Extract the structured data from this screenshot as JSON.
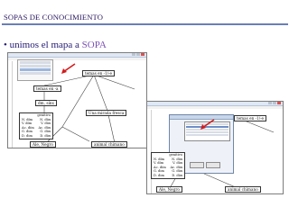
{
  "slide": {
    "title": "SOPAS DE CONOCIMIENTO",
    "bullet_symbol": "•",
    "bullet_text": "unimos el mapa a",
    "bullet_accent": "SOPA",
    "colors": {
      "title": "#2a1760",
      "divider": "#6a7fb6",
      "bullet": "#231873",
      "accent": "#7a4fb5"
    }
  },
  "screenshot_left": {
    "central_node": "temas en -1/-e",
    "child_nodes": [
      "temas en -a",
      "dm, sínx",
      "Ale, Negro",
      "Una mirada fresca",
      "animal chimano"
    ],
    "list_node": {
      "header": "genitivo",
      "rows": [
        {
          "left": "N. dím",
          "right": "N. dúx"
        },
        {
          "left": "V. dím",
          "right": "V. dúx"
        },
        {
          "left": "Ac. dím",
          "right": "Ac. dúx"
        },
        {
          "left": "G. dim",
          "right": "G. dúx"
        },
        {
          "left": "D. dim",
          "right": "D. dúx"
        },
        {
          "left": "Ab. dim",
          "right": "Ab. dúx"
        }
      ]
    }
  },
  "screenshot_right": {
    "central_node": "temas en -1/-e",
    "child_nodes": [
      "Ale, Negro",
      "animal chimano"
    ],
    "list_node": {
      "header": "genitivo",
      "rows": [
        {
          "left": "N. dím",
          "right": "N. dúx"
        },
        {
          "left": "V. dím",
          "right": "V. dúx"
        },
        {
          "left": "Ac. dím",
          "right": "Ac. dúx"
        },
        {
          "left": "G. dim",
          "right": "G. dúx"
        },
        {
          "left": "D. dim",
          "right": "D. dúx"
        },
        {
          "left": "Ab. dim",
          "right": "Ab. dúx"
        }
      ]
    }
  },
  "icons": {
    "pointer": "red-arrow-icon"
  }
}
